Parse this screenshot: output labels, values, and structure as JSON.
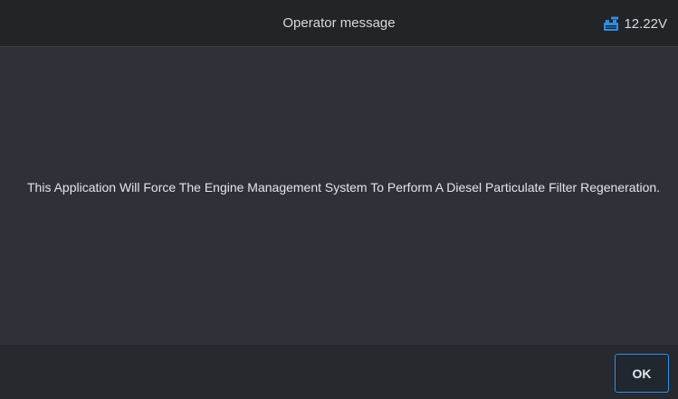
{
  "header": {
    "title": "Operator message",
    "battery_icon": "car-battery-icon",
    "voltage": "12.22V"
  },
  "main": {
    "message": "This Application Will Force The Engine Management System To Perform A Diesel Particulate Filter Regeneration."
  },
  "footer": {
    "ok_label": "OK"
  },
  "colors": {
    "accent": "#2f8ee6",
    "header_bg": "#222428",
    "content_bg": "#2e3137",
    "footer_bg": "#26292d",
    "text": "#e3e5e8"
  }
}
